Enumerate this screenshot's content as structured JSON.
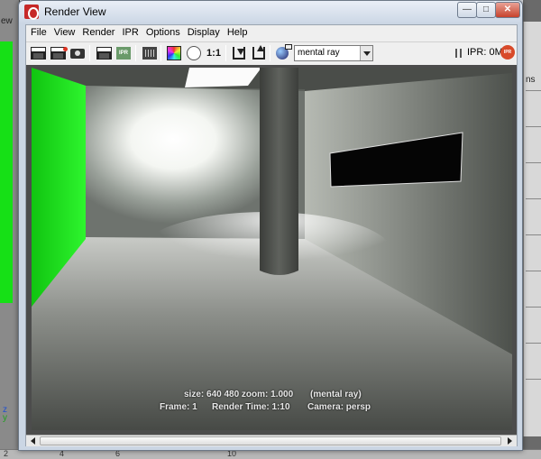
{
  "background": {
    "left_label": "ew",
    "right_label": "ns",
    "ruler_numbers": [
      "2",
      "4",
      "6",
      "10"
    ],
    "axis": {
      "z": "z",
      "y": "y"
    }
  },
  "window": {
    "title": "Render View",
    "controls": {
      "minimize": "—",
      "maximize": "□",
      "close": "✕"
    }
  },
  "menu": [
    "File",
    "View",
    "Render",
    "IPR",
    "Options",
    "Display",
    "Help"
  ],
  "toolbar": {
    "ratio_label": "1:1",
    "ipr_button_label": "IPR",
    "renderer": "mental ray",
    "ipr_memory": "IPR: 0MB",
    "ipr_badge": "IPR"
  },
  "render_info": {
    "size": "size:  640  480 zoom: 1.000",
    "renderer": "(mental ray)",
    "frame": "Frame: 1",
    "render_time": "Render Time: 1:10",
    "camera": "Camera: persp"
  },
  "colors": {
    "green_wall": "#19e619",
    "window_frame": "#cbd6e4",
    "close_button": "#c7422c"
  }
}
